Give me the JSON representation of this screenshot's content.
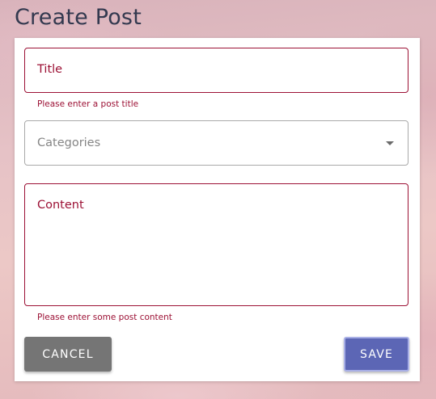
{
  "page": {
    "title": "Create Post"
  },
  "form": {
    "title_field": {
      "label": "Title",
      "value": "",
      "helper": "Please enter a post title",
      "state": "error"
    },
    "categories_field": {
      "label": "Categories",
      "selected": "",
      "icon": "arrow-drop-down-icon"
    },
    "content_field": {
      "label": "Content",
      "value": "",
      "helper": "Please enter some post content",
      "state": "error"
    },
    "actions": {
      "cancel_label": "CANCEL",
      "save_label": "SAVE"
    }
  },
  "colors": {
    "error": "#9c1135",
    "title_text": "#33394f",
    "cancel_button": "#757575",
    "save_button": "#5c66b5"
  }
}
